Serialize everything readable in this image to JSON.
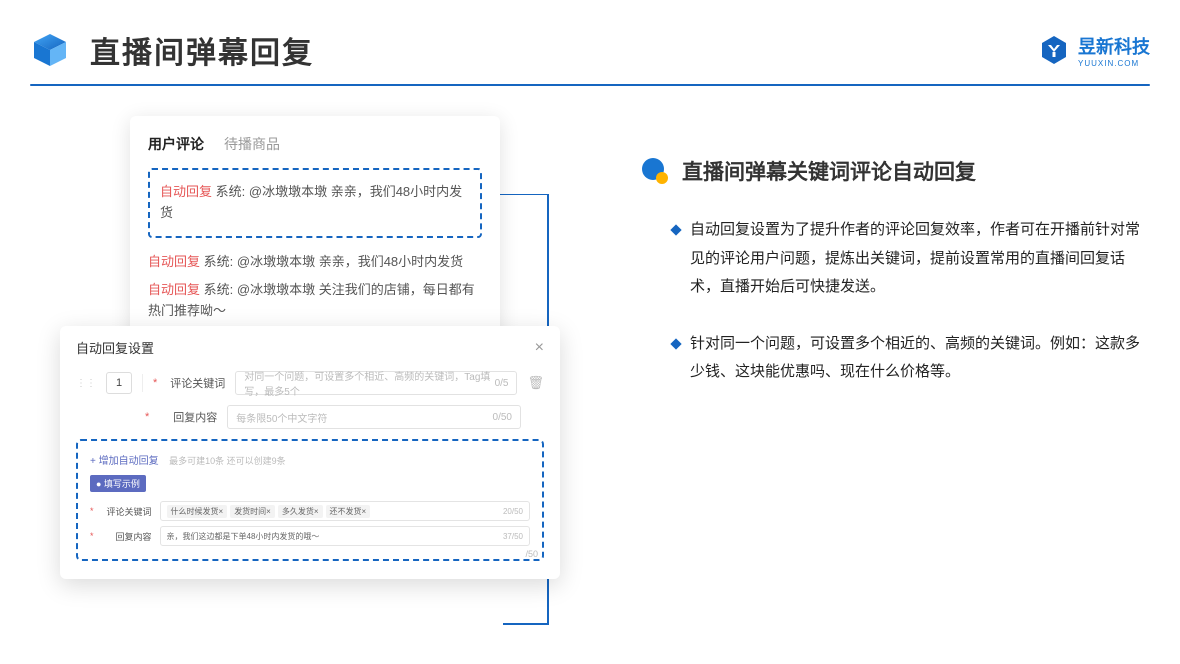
{
  "header": {
    "title": "直播间弹幕回复",
    "logo_text": "昱新科技",
    "logo_sub": "YUUXIN.COM"
  },
  "card1": {
    "tab1": "用户评论",
    "tab2": "待播商品",
    "reply_label": "自动回复",
    "sys_label": "系统:",
    "row1": "@冰墩墩本墩 亲亲，我们48小时内发货",
    "row2": "@冰墩墩本墩 亲亲，我们48小时内发货",
    "row3": "@冰墩墩本墩 关注我们的店铺，每日都有热门推荐呦～"
  },
  "card2": {
    "title": "自动回复设置",
    "num": "1",
    "label1": "评论关键词",
    "ph1": "对同一个问题，可设置多个相近、高频的关键词，Tag填写，最多5个",
    "count1": "0/5",
    "label2": "回复内容",
    "ph2": "每条限50个中文字符",
    "count2": "0/50",
    "add": "+ 增加自动回复",
    "add_hint": "最多可建10条 还可以创建9条",
    "badge": "● 填写示例",
    "ex_label1": "评论关键词",
    "tag1": "什么时候发货×",
    "tag2": "发货时间×",
    "tag3": "多久发货×",
    "tag4": "还不发货×",
    "ex_count1": "20/50",
    "ex_label2": "回复内容",
    "ex_text": "亲，我们这边都是下单48小时内发货的哦～",
    "ex_count2": "37/50",
    "outside": "/50"
  },
  "right": {
    "title": "直播间弹幕关键词评论自动回复",
    "b1": "自动回复设置为了提升作者的评论回复效率，作者可在开播前针对常见的评论用户问题，提炼出关键词，提前设置常用的直播间回复话术，直播开始后可快捷发送。",
    "b2": "针对同一个问题，可设置多个相近的、高频的关键词。例如：这款多少钱、这块能优惠吗、现在什么价格等。"
  }
}
